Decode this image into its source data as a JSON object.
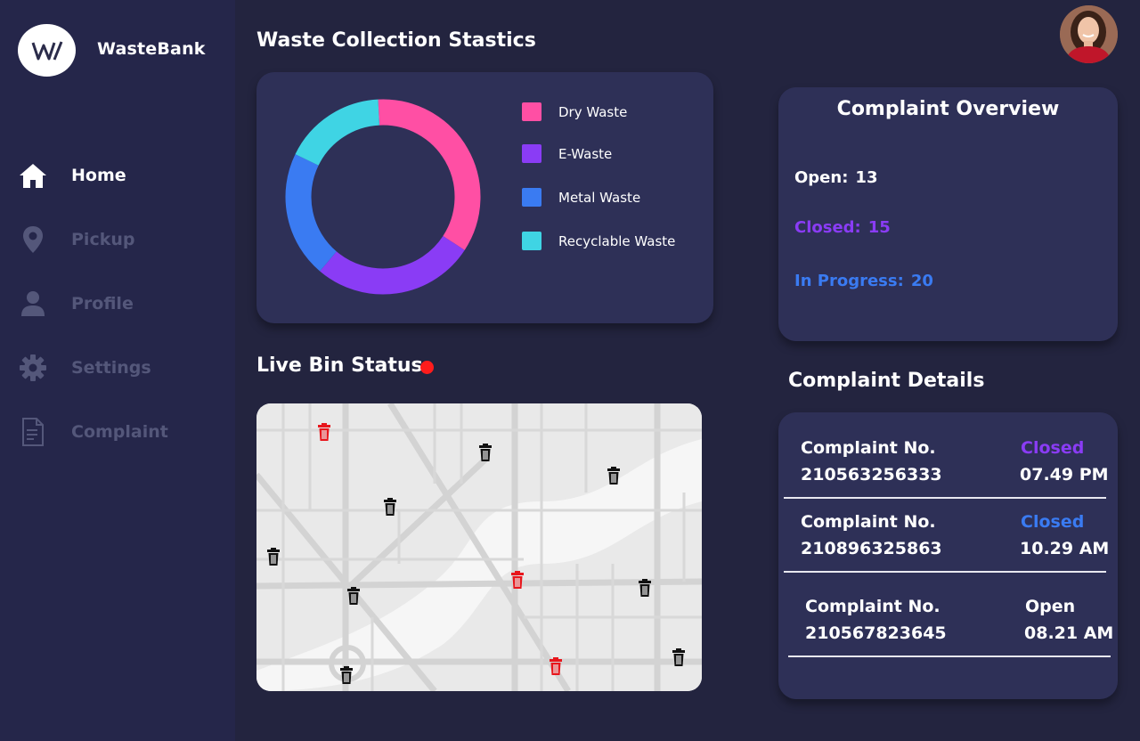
{
  "brand": {
    "name": "WasteBank",
    "logo_text": "W/"
  },
  "nav": [
    {
      "label": "Home",
      "icon": "home-icon",
      "active": true
    },
    {
      "label": "Pickup",
      "icon": "location-pin-icon",
      "active": false
    },
    {
      "label": "Profile",
      "icon": "person-icon",
      "active": false
    },
    {
      "label": "Settings",
      "icon": "gear-icon",
      "active": false
    },
    {
      "label": "Complaint",
      "icon": "document-icon",
      "active": false
    }
  ],
  "main": {
    "title": "Waste Collection Stastics"
  },
  "chart_data": {
    "type": "pie",
    "donut": true,
    "title": "",
    "categories": [
      "Dry Waste",
      "E-Waste",
      "Metal Waste",
      "Recyclable Waste"
    ],
    "values": [
      35,
      27,
      21,
      17
    ],
    "colors": [
      "#ff4fa4",
      "#8a3cf5",
      "#3a7bf2",
      "#3fd4e4"
    ],
    "legend_position": "right"
  },
  "live": {
    "title": "Live Bin Status",
    "status_color": "#ff1c1c"
  },
  "overview": {
    "title": "Complaint Overview",
    "open": {
      "label": "Open:",
      "value": "13",
      "color": "#ffffff"
    },
    "closed": {
      "label": "Closed:",
      "value": "15",
      "color": "#8a3cf5"
    },
    "progress": {
      "label": "In Progress:",
      "value": "20",
      "color": "#3a7bf2"
    }
  },
  "details": {
    "title": "Complaint Details",
    "rows": [
      {
        "label": "Complaint No.",
        "number": "210563256333",
        "status": "Closed",
        "status_color": "#8a3cf5",
        "time": "07.49 PM"
      },
      {
        "label": "Complaint No.",
        "number": "210896325863",
        "status": "Closed",
        "status_color": "#3a7bf2",
        "time": "10.29 AM"
      },
      {
        "label": "Complaint No.",
        "number": "210567823645",
        "status": "Open",
        "status_color": "#ffffff",
        "time": "08.21 AM"
      }
    ]
  }
}
